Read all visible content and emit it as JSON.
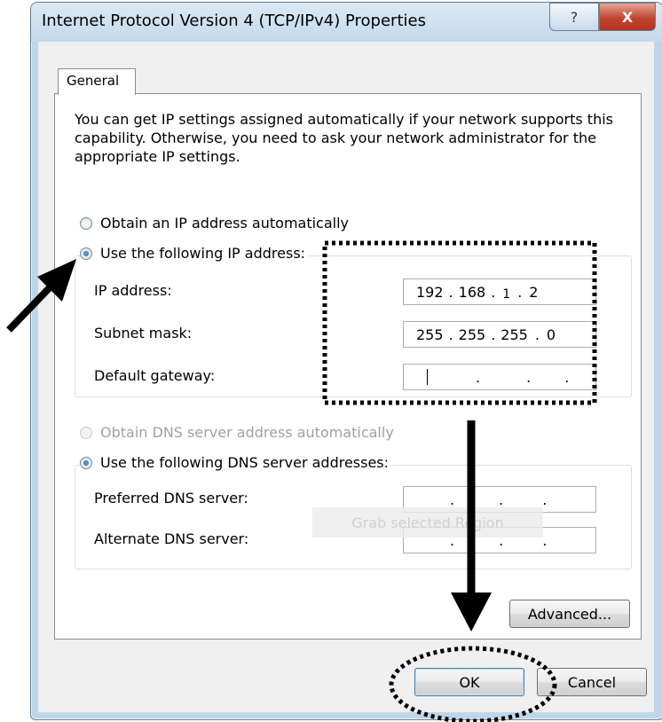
{
  "window": {
    "title": "Internet Protocol Version 4 (TCP/IPv4) Properties",
    "help_glyph": "?",
    "close_glyph": "X"
  },
  "tabs": [
    {
      "label": "General"
    }
  ],
  "description": "You can get IP settings assigned automatically if your network supports this capability. Otherwise, you need to ask your network administrator for the appropriate IP settings.",
  "ip": {
    "auto_label": "Obtain an IP address automatically",
    "manual_label": "Use the following IP address:",
    "fields": [
      {
        "label": "IP address:",
        "octets": [
          "192",
          "168",
          "1",
          "2"
        ]
      },
      {
        "label": "Subnet mask:",
        "octets": [
          "255",
          "255",
          "255",
          "0"
        ]
      },
      {
        "label": "Default gateway:",
        "octets": [
          "",
          "",
          "",
          ""
        ]
      }
    ]
  },
  "dns": {
    "auto_label": "Obtain DNS server address automatically",
    "manual_label": "Use the following DNS server addresses:",
    "fields": [
      {
        "label": "Preferred DNS server:",
        "octets": [
          "",
          "",
          "",
          ""
        ]
      },
      {
        "label": "Alternate DNS server:",
        "octets": [
          "",
          "",
          "",
          ""
        ]
      }
    ]
  },
  "grab_overlay_text": "Grab selected Region",
  "buttons": {
    "advanced": "Advanced...",
    "ok": "OK",
    "cancel": "Cancel"
  },
  "colors": {
    "annotation": "#000000",
    "selected_radio": "#1f5fb3",
    "close_button": "#c0452e"
  }
}
